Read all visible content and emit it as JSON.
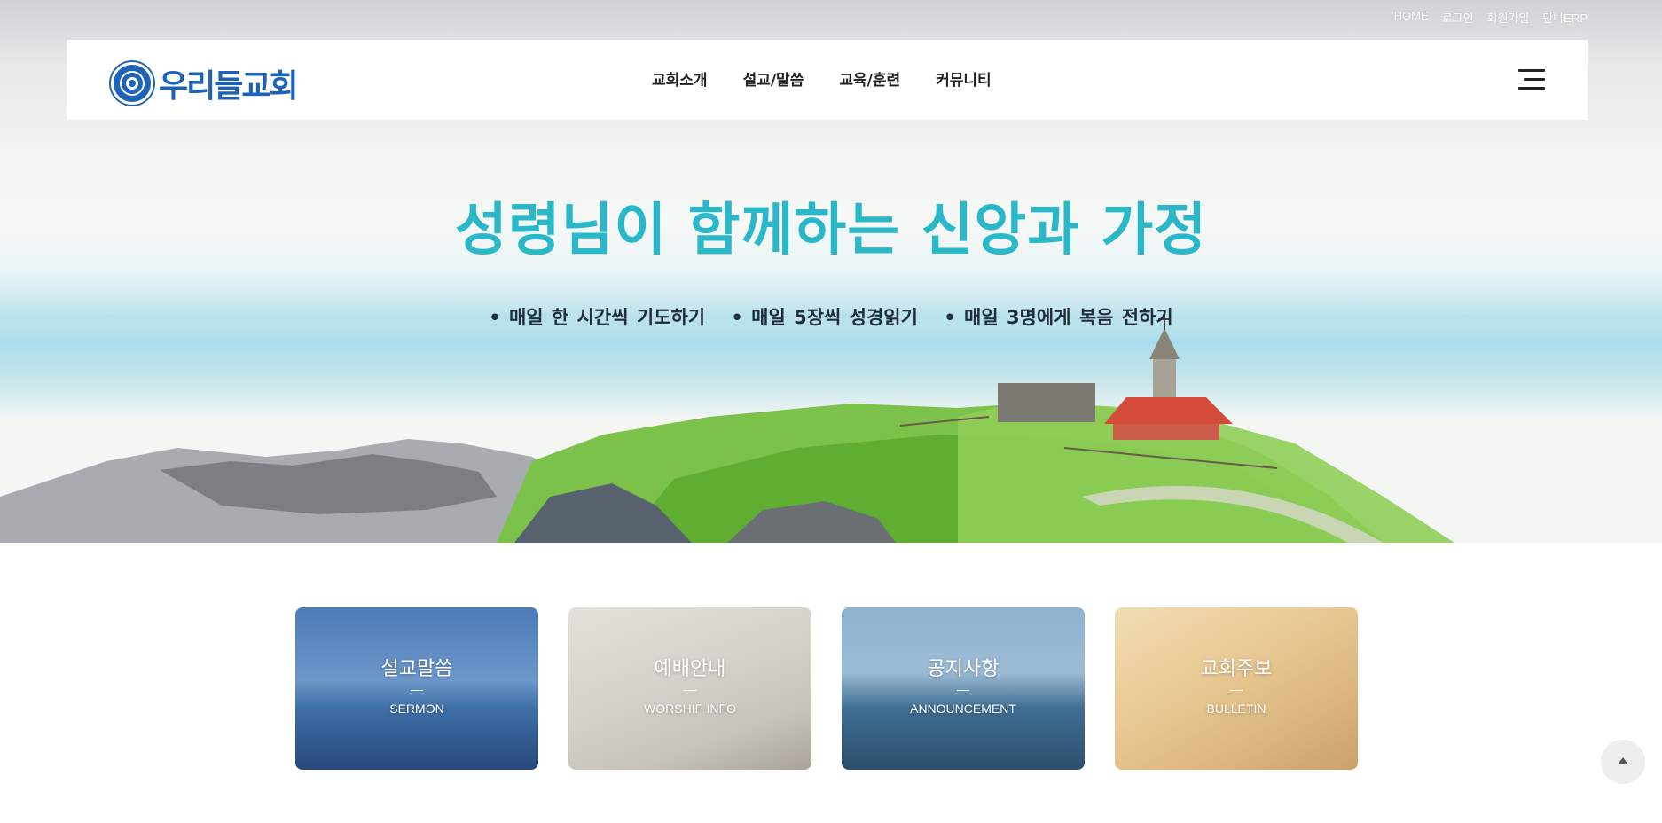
{
  "top_links": [
    "HOME",
    "로그인",
    "회원가입",
    "만나ERP"
  ],
  "logo": {
    "text": "우리들교회"
  },
  "nav": [
    "교회소개",
    "설교/말씀",
    "교육/훈련",
    "커뮤니티"
  ],
  "hero": {
    "slogan": "성령님이 함께하는 신앙과 가정",
    "items": [
      "• 매일 한 시간씩 기도하기",
      "• 매일 5장씩 성경읽기",
      "• 매일 3명에게 복음 전하기"
    ]
  },
  "cards": [
    {
      "title": "설교말씀",
      "sub": "SERMON"
    },
    {
      "title": "예배안내",
      "sub": "WORSHIP INFO"
    },
    {
      "title": "공지사항",
      "sub": "ANNOUNCEMENT"
    },
    {
      "title": "교회주보",
      "sub": "BULLETIN"
    }
  ],
  "icons": {
    "menu": "hamburger-icon",
    "scroll_top": "arrow-up-icon",
    "emblem": "church-emblem-icon"
  },
  "colors": {
    "brand_blue": "#1d62b6",
    "slogan_teal": "#2ab8c8"
  }
}
